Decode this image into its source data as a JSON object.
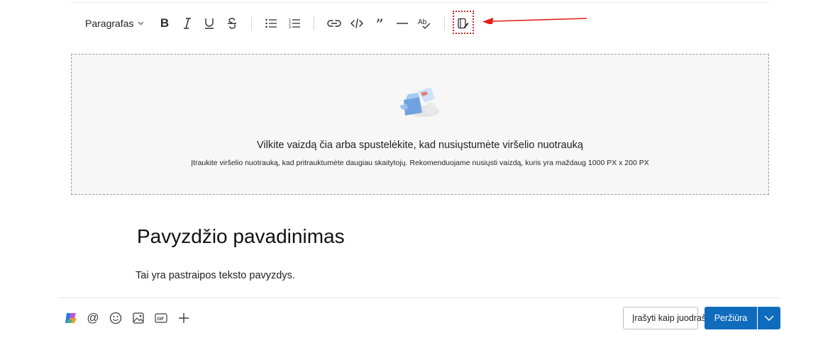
{
  "toolbar": {
    "paragraph_label": "Paragrafas",
    "buttons": [
      "bold-icon",
      "italic-icon",
      "underline-icon",
      "strikethrough-icon",
      "bulleted-list-icon",
      "numbered-list-icon",
      "link-icon",
      "code-icon",
      "quote-icon",
      "horizontal-rule-icon",
      "spellcheck-icon",
      "notes-pen-icon"
    ],
    "highlight_color": "#c62828"
  },
  "cover": {
    "title": "Vilkite vaizdą čia arba spustelėkite, kad nusiųstumėte viršelio nuotrauką",
    "subtitle": "Įtraukite viršelio nuotrauką, kad pritrauktumėte daugiau skaitytojų. Rekomenduojame nusiųsti vaizdą, kuris yra maždaug 1000 PX x 200 PX"
  },
  "document": {
    "title": "Pavyzdžio pavadinimas",
    "paragraph": "Tai yra pastraipos teksto pavyzdys."
  },
  "bottom_bar": {
    "icons": [
      "copilot-icon",
      "mention-icon",
      "emoji-icon",
      "image-icon",
      "gif-icon",
      "add-icon"
    ],
    "draft_label": "Įrašyti kaip juodraštį",
    "preview_label": "Peržiūra",
    "accent_color": "#0f6cbd"
  }
}
